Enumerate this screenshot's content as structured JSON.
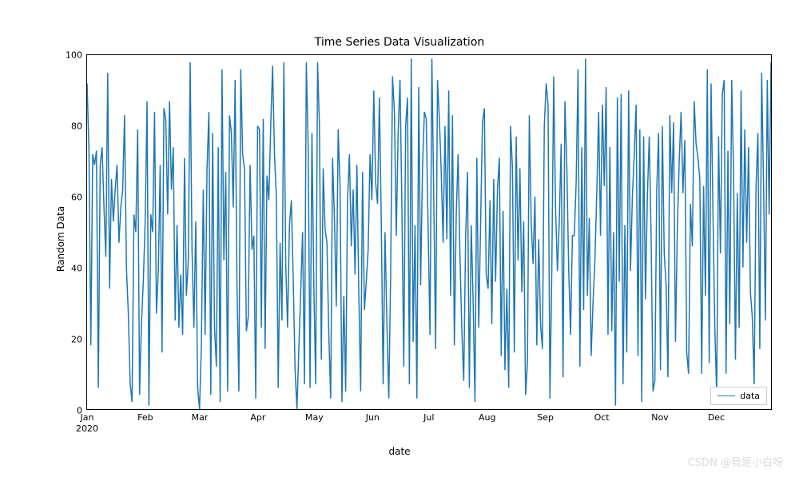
{
  "watermark": "CSDN @我是小白呀",
  "chart_data": {
    "type": "line",
    "title": "Time Series Data Visualization",
    "xlabel": "date",
    "ylabel": "Random Data",
    "ylim": [
      0,
      100
    ],
    "xlim": [
      "2020-01-01",
      "2020-12-31"
    ],
    "yticks": [
      0,
      20,
      40,
      60,
      80,
      100
    ],
    "xticks": [
      "Jan",
      "Feb",
      "Mar",
      "Apr",
      "May",
      "Jun",
      "Jul",
      "Aug",
      "Sep",
      "Oct",
      "Nov",
      "Dec"
    ],
    "xtick_year": "2020",
    "legend": [
      "data"
    ],
    "series": [
      {
        "name": "data",
        "color": "#1f77b4",
        "x_index": "daily 2020-01-01 to 2020-12-31 (366 points)",
        "values": [
          92,
          73,
          18,
          72,
          69,
          73,
          6,
          69,
          74,
          57,
          43,
          95,
          34,
          65,
          53,
          62,
          69,
          47,
          57,
          62,
          83,
          40,
          27,
          7,
          2,
          55,
          50,
          79,
          4,
          24,
          36,
          53,
          87,
          1,
          55,
          50,
          84,
          27,
          39,
          69,
          16,
          85,
          82,
          55,
          87,
          62,
          74,
          25,
          52,
          23,
          38,
          21,
          71,
          32,
          42,
          98,
          45,
          23,
          53,
          6,
          0,
          18,
          62,
          21,
          68,
          84,
          4,
          78,
          23,
          12,
          74,
          2,
          96,
          42,
          67,
          5,
          83,
          78,
          57,
          93,
          35,
          5,
          96,
          72,
          68,
          22,
          26,
          69,
          45,
          49,
          3,
          80,
          79,
          23,
          82,
          17,
          66,
          59,
          80,
          97,
          72,
          60,
          6,
          47,
          25,
          98,
          41,
          23,
          52,
          59,
          37,
          11,
          0,
          17,
          33,
          50,
          7,
          98,
          74,
          6,
          78,
          35,
          7,
          98,
          80,
          14,
          68,
          51,
          47,
          21,
          3,
          71,
          54,
          29,
          79,
          63,
          2,
          32,
          5,
          59,
          72,
          46,
          62,
          38,
          69,
          33,
          5,
          67,
          28,
          36,
          45,
          72,
          59,
          90,
          64,
          58,
          88,
          53,
          7,
          50,
          24,
          3,
          38,
          94,
          84,
          49,
          78,
          93,
          57,
          12,
          80,
          88,
          7,
          99,
          19,
          52,
          3,
          91,
          35,
          68,
          84,
          82,
          51,
          21,
          99,
          60,
          17,
          93,
          82,
          67,
          47,
          80,
          48,
          90,
          32,
          83,
          18,
          55,
          72,
          43,
          22,
          8,
          48,
          67,
          6,
          52,
          31,
          2,
          71,
          23,
          52,
          81,
          85,
          38,
          34,
          59,
          24,
          65,
          36,
          62,
          71,
          15,
          56,
          11,
          34,
          6,
          80,
          68,
          16,
          77,
          42,
          68,
          33,
          53,
          4,
          13,
          83,
          53,
          41,
          60,
          18,
          48,
          24,
          17,
          80,
          92,
          86,
          3,
          39,
          94,
          57,
          39,
          53,
          75,
          9,
          87,
          69,
          40,
          21,
          49,
          49,
          64,
          96,
          12,
          74,
          28,
          99,
          32,
          54,
          15,
          30,
          42,
          61,
          84,
          49,
          86,
          63,
          91,
          21,
          74,
          22,
          50,
          1,
          88,
          36,
          89,
          7,
          52,
          16,
          90,
          39,
          60,
          72,
          86,
          15,
          79,
          2,
          77,
          31,
          60,
          77,
          49,
          5,
          8,
          62,
          78,
          11,
          80,
          44,
          35,
          9,
          83,
          61,
          81,
          19,
          51,
          70,
          84,
          61,
          76,
          16,
          10,
          58,
          46,
          87,
          75,
          71,
          65,
          10,
          63,
          32,
          96,
          13,
          92,
          56,
          23,
          4,
          77,
          44,
          89,
          93,
          10,
          73,
          24,
          93,
          67,
          14,
          61,
          23,
          90,
          40,
          79,
          47,
          74,
          33,
          26,
          7,
          63,
          78,
          17,
          95,
          64,
          25,
          93,
          55,
          98
        ]
      }
    ]
  }
}
